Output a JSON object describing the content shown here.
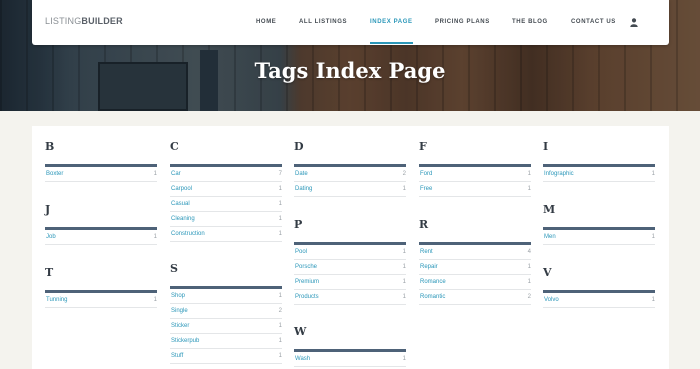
{
  "brand": {
    "light": "LISTING",
    "bold": "BUILDER"
  },
  "nav": {
    "items": [
      "HOME",
      "ALL LISTINGS",
      "INDEX PAGE",
      "PRICING PLANS",
      "THE BLOG",
      "CONTACT US"
    ],
    "active": "INDEX PAGE",
    "user_icon": "user-icon"
  },
  "page_title": "Tags Index Page",
  "columns": [
    {
      "groups": [
        {
          "letter": "B",
          "tags": [
            {
              "name": "Boxter",
              "count": "1"
            }
          ]
        },
        {
          "letter": "J",
          "tags": [
            {
              "name": "Job",
              "count": "1"
            }
          ]
        },
        {
          "letter": "T",
          "tags": [
            {
              "name": "Tunning",
              "count": "1"
            }
          ]
        }
      ]
    },
    {
      "groups": [
        {
          "letter": "C",
          "tags": [
            {
              "name": "Car",
              "count": "7"
            },
            {
              "name": "Carpool",
              "count": "1"
            },
            {
              "name": "Casual",
              "count": "1"
            },
            {
              "name": "Cleaning",
              "count": "1"
            },
            {
              "name": "Construction",
              "count": "1"
            }
          ]
        },
        {
          "letter": "S",
          "tags": [
            {
              "name": "Shop",
              "count": "1"
            },
            {
              "name": "Single",
              "count": "2"
            },
            {
              "name": "Sticker",
              "count": "1"
            },
            {
              "name": "Stickerpub",
              "count": "1"
            },
            {
              "name": "Stuff",
              "count": "1"
            }
          ]
        }
      ]
    },
    {
      "groups": [
        {
          "letter": "D",
          "tags": [
            {
              "name": "Date",
              "count": "2"
            },
            {
              "name": "Dating",
              "count": "1"
            }
          ]
        },
        {
          "letter": "P",
          "tags": [
            {
              "name": "Pool",
              "count": "1"
            },
            {
              "name": "Porsche",
              "count": "1"
            },
            {
              "name": "Premium",
              "count": "1"
            },
            {
              "name": "Products",
              "count": "1"
            }
          ]
        },
        {
          "letter": "W",
          "tags": [
            {
              "name": "Wash",
              "count": "1"
            }
          ]
        }
      ]
    },
    {
      "groups": [
        {
          "letter": "F",
          "tags": [
            {
              "name": "Ford",
              "count": "1"
            },
            {
              "name": "Free",
              "count": "1"
            }
          ]
        },
        {
          "letter": "R",
          "tags": [
            {
              "name": "Rent",
              "count": "4"
            },
            {
              "name": "Repair",
              "count": "1"
            },
            {
              "name": "Romance",
              "count": "1"
            },
            {
              "name": "Romantic",
              "count": "2"
            }
          ]
        }
      ]
    },
    {
      "groups": [
        {
          "letter": "I",
          "tags": [
            {
              "name": "Infographic",
              "count": "1"
            }
          ]
        },
        {
          "letter": "M",
          "tags": [
            {
              "name": "Men",
              "count": "1"
            }
          ]
        },
        {
          "letter": "V",
          "tags": [
            {
              "name": "Volvo",
              "count": "1"
            }
          ]
        }
      ]
    }
  ],
  "colors": {
    "accent": "#2b97b9",
    "rule": "#4e6278",
    "page_bg": "#f4f3ee"
  }
}
